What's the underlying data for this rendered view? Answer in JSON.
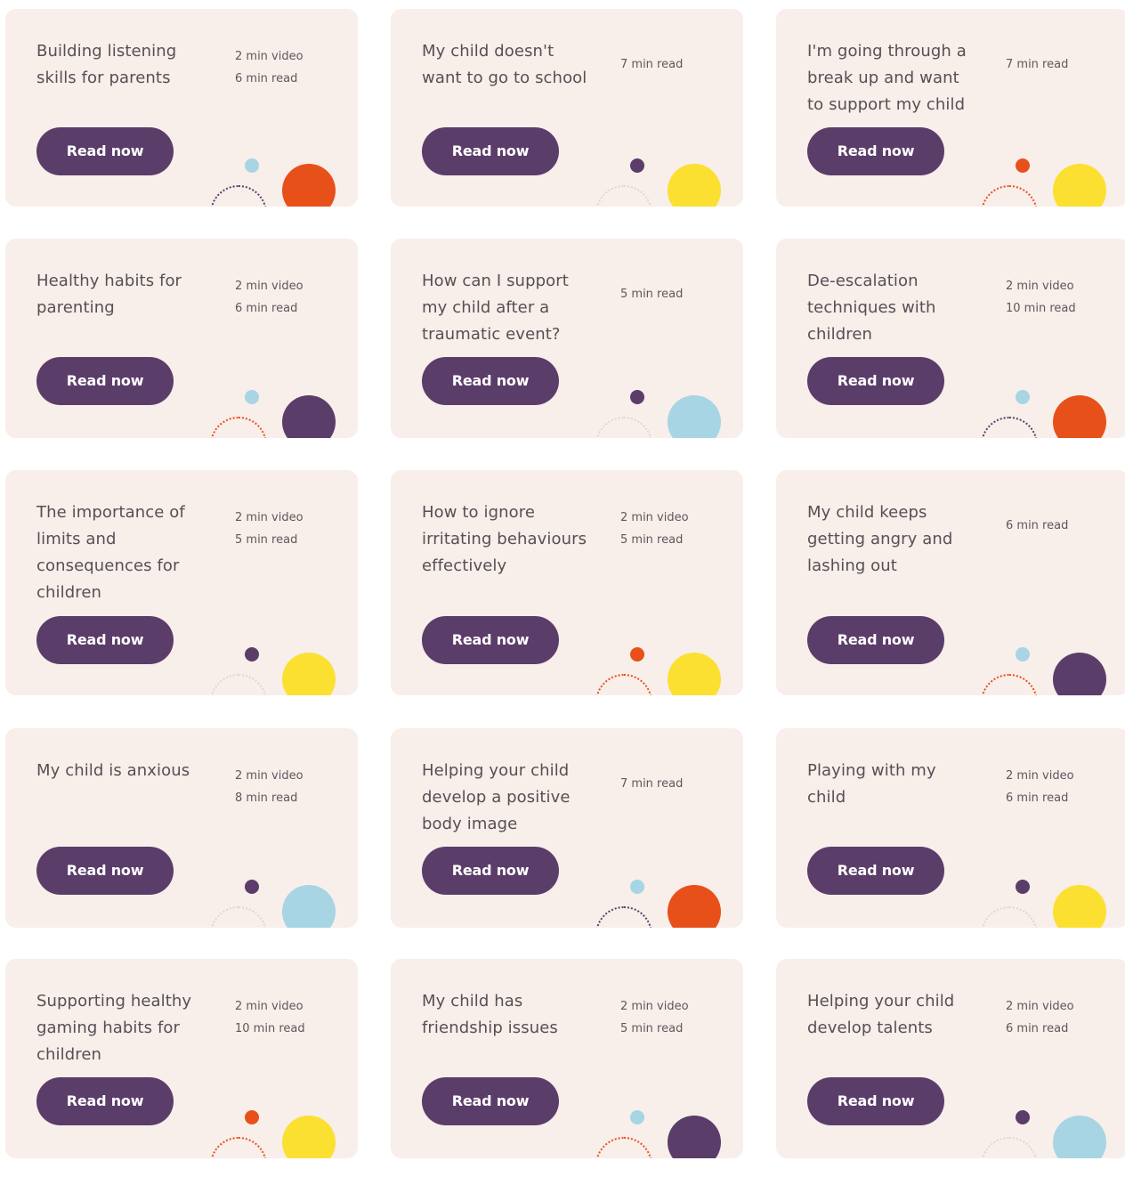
{
  "colors": {
    "card_bg": "#f8eeea",
    "button": "#5b3d6a",
    "orange": "#e8501a",
    "yellow": "#fbe032",
    "purple": "#5b3d6a",
    "lightblue": "#a7d5e4"
  },
  "cards": [
    {
      "title": "Building listening skills for parents",
      "meta": [
        "2 min video",
        "6 min read"
      ],
      "button": "Read now",
      "big_color": "#e8501a",
      "small_color": "#a7d5e4",
      "arc_color": "#5b3d6a"
    },
    {
      "title": "My child doesn't want to go to school",
      "meta": [
        "7 min read"
      ],
      "button": "Read now",
      "big_color": "#fbe032",
      "small_color": "#5b3d6a",
      "arc_color": "#e0d6d6"
    },
    {
      "title": "I'm going through a break up and want to support my child",
      "meta": [
        "7 min read"
      ],
      "button": "Read now",
      "big_color": "#fbe032",
      "small_color": "#e8501a",
      "arc_color": "#e8501a"
    },
    {
      "title": "Healthy habits for parenting",
      "meta": [
        "2 min video",
        "6 min read"
      ],
      "button": "Read now",
      "big_color": "#5b3d6a",
      "small_color": "#a7d5e4",
      "arc_color": "#e8501a"
    },
    {
      "title": "How can I support my child after a traumatic event?",
      "meta": [
        "5 min read"
      ],
      "button": "Read now",
      "big_color": "#a7d5e4",
      "small_color": "#5b3d6a",
      "arc_color": "#e0d6d6"
    },
    {
      "title": "De-escalation techniques with children",
      "meta": [
        "2 min video",
        "10 min read"
      ],
      "button": "Read now",
      "big_color": "#e8501a",
      "small_color": "#a7d5e4",
      "arc_color": "#5b3d6a"
    },
    {
      "title": "The importance of limits and consequences for children",
      "meta": [
        "2 min video",
        "5 min read"
      ],
      "button": "Read now",
      "big_color": "#fbe032",
      "small_color": "#5b3d6a",
      "arc_color": "#e0d6d6"
    },
    {
      "title": "How to ignore irritating behaviours effectively",
      "meta": [
        "2 min video",
        "5 min read"
      ],
      "button": "Read now",
      "big_color": "#fbe032",
      "small_color": "#e8501a",
      "arc_color": "#e8501a"
    },
    {
      "title": "My child keeps getting angry and lashing out",
      "meta": [
        "6 min read"
      ],
      "button": "Read now",
      "big_color": "#5b3d6a",
      "small_color": "#a7d5e4",
      "arc_color": "#e8501a"
    },
    {
      "title": "My child is anxious",
      "meta": [
        "2 min video",
        "8 min read"
      ],
      "button": "Read now",
      "big_color": "#a7d5e4",
      "small_color": "#5b3d6a",
      "arc_color": "#e0d6d6"
    },
    {
      "title": "Helping your child develop a positive body image",
      "meta": [
        "7 min read"
      ],
      "button": "Read now",
      "big_color": "#e8501a",
      "small_color": "#a7d5e4",
      "arc_color": "#5b3d6a"
    },
    {
      "title": "Playing with my child",
      "meta": [
        "2 min video",
        "6 min read"
      ],
      "button": "Read now",
      "big_color": "#fbe032",
      "small_color": "#5b3d6a",
      "arc_color": "#e0d6d6"
    },
    {
      "title": "Supporting healthy gaming habits for children",
      "meta": [
        "2 min video",
        "10 min read"
      ],
      "button": "Read now",
      "big_color": "#fbe032",
      "small_color": "#e8501a",
      "arc_color": "#e8501a"
    },
    {
      "title": "My child has friendship issues",
      "meta": [
        "2 min video",
        "5 min read"
      ],
      "button": "Read now",
      "big_color": "#5b3d6a",
      "small_color": "#a7d5e4",
      "arc_color": "#e8501a"
    },
    {
      "title": "Helping your child develop talents",
      "meta": [
        "2 min video",
        "6 min read"
      ],
      "button": "Read now",
      "big_color": "#a7d5e4",
      "small_color": "#5b3d6a",
      "arc_color": "#e0d6d6"
    }
  ]
}
